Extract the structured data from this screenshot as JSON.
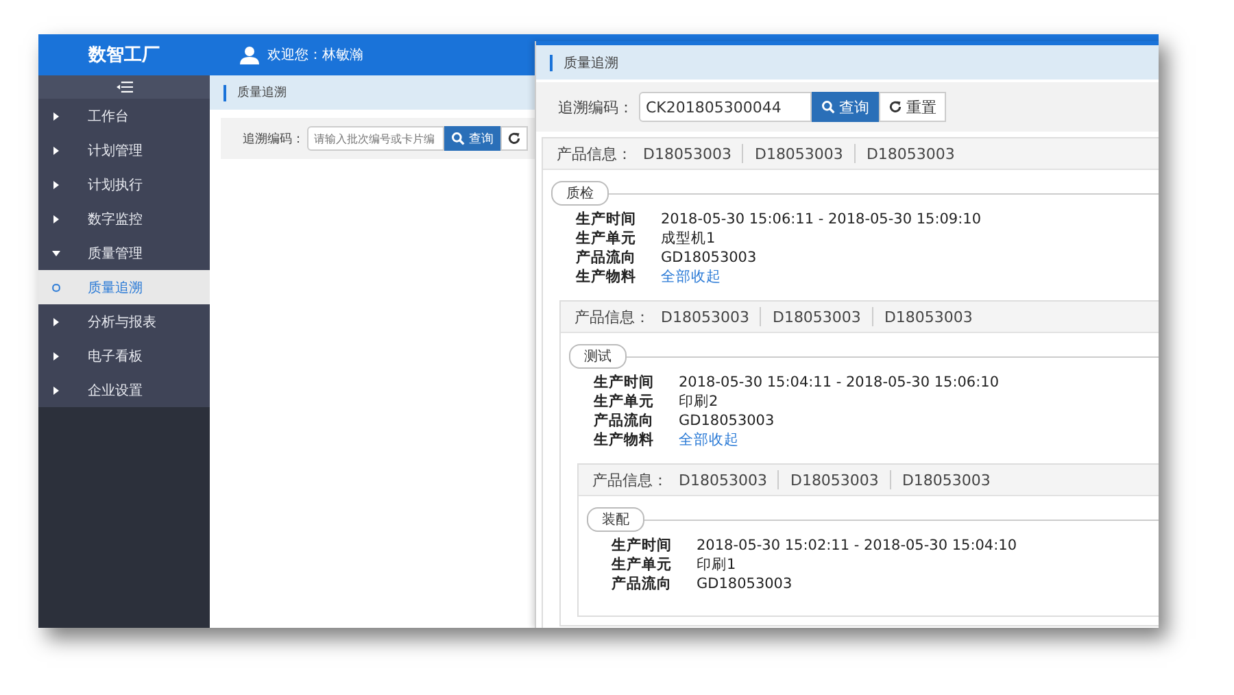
{
  "app": {
    "title": "数智工厂",
    "welcome": "欢迎您：林敏瀚"
  },
  "sidebar": {
    "items": [
      {
        "label": "工作台",
        "kind": "group",
        "expanded": false,
        "selected": false
      },
      {
        "label": "计划管理",
        "kind": "group",
        "expanded": false,
        "selected": false
      },
      {
        "label": "计划执行",
        "kind": "group",
        "expanded": false,
        "selected": false
      },
      {
        "label": "数字监控",
        "kind": "group",
        "expanded": false,
        "selected": false
      },
      {
        "label": "质量管理",
        "kind": "group",
        "expanded": true,
        "selected": false
      },
      {
        "label": "质量追溯",
        "kind": "leaf",
        "selected": true
      },
      {
        "label": "分析与报表",
        "kind": "group",
        "expanded": false,
        "selected": false
      },
      {
        "label": "电子看板",
        "kind": "group",
        "expanded": false,
        "selected": false
      },
      {
        "label": "企业设置",
        "kind": "group",
        "expanded": false,
        "selected": false
      }
    ]
  },
  "page": {
    "breadcrumb": "质量追溯",
    "search": {
      "label": "追溯编码：",
      "placeholder": "请输入批次编号或卡片编",
      "button": "查询"
    }
  },
  "trace_panel": {
    "title": "质量追溯",
    "search": {
      "label": "追溯编码：",
      "value": "CK201805300044",
      "buttons": [
        "查询",
        "重置"
      ]
    },
    "record": {
      "info_label": "产品信息：",
      "codes": [
        "D18053003",
        "D18053003",
        "D18053003"
      ],
      "stage": "质检",
      "fields": [
        {
          "label": "生产时间",
          "value": "2018-05-30 15:06:11 - 2018-05-30 15:09:10",
          "kind": "text"
        },
        {
          "label": "生产单元",
          "value": "成型机1",
          "kind": "text"
        },
        {
          "label": "产品流向",
          "value": "GD18053003",
          "kind": "text"
        },
        {
          "label": "生产物料",
          "value": "全部收起",
          "kind": "link"
        }
      ],
      "children": [
        {
          "info_label": "产品信息：",
          "codes": [
            "D18053003",
            "D18053003",
            "D18053003"
          ],
          "stage": "测试",
          "fields": [
            {
              "label": "生产时间",
              "value": "2018-05-30 15:04:11 - 2018-05-30 15:06:10",
              "kind": "text"
            },
            {
              "label": "生产单元",
              "value": "印刷2",
              "kind": "text"
            },
            {
              "label": "产品流向",
              "value": "GD18053003",
              "kind": "text"
            },
            {
              "label": "生产物料",
              "value": "全部收起",
              "kind": "link"
            }
          ],
          "children": [
            {
              "info_label": "产品信息：",
              "codes": [
                "D18053003",
                "D18053003",
                "D18053003"
              ],
              "stage": "装配",
              "fields": [
                {
                  "label": "生产时间",
                  "value": "2018-05-30 15:02:11 - 2018-05-30 15:04:10",
                  "kind": "text"
                },
                {
                  "label": "生产单元",
                  "value": "印刷1",
                  "kind": "text"
                },
                {
                  "label": "产品流向",
                  "value": "GD18053003",
                  "kind": "text"
                }
              ]
            }
          ]
        }
      ]
    }
  }
}
